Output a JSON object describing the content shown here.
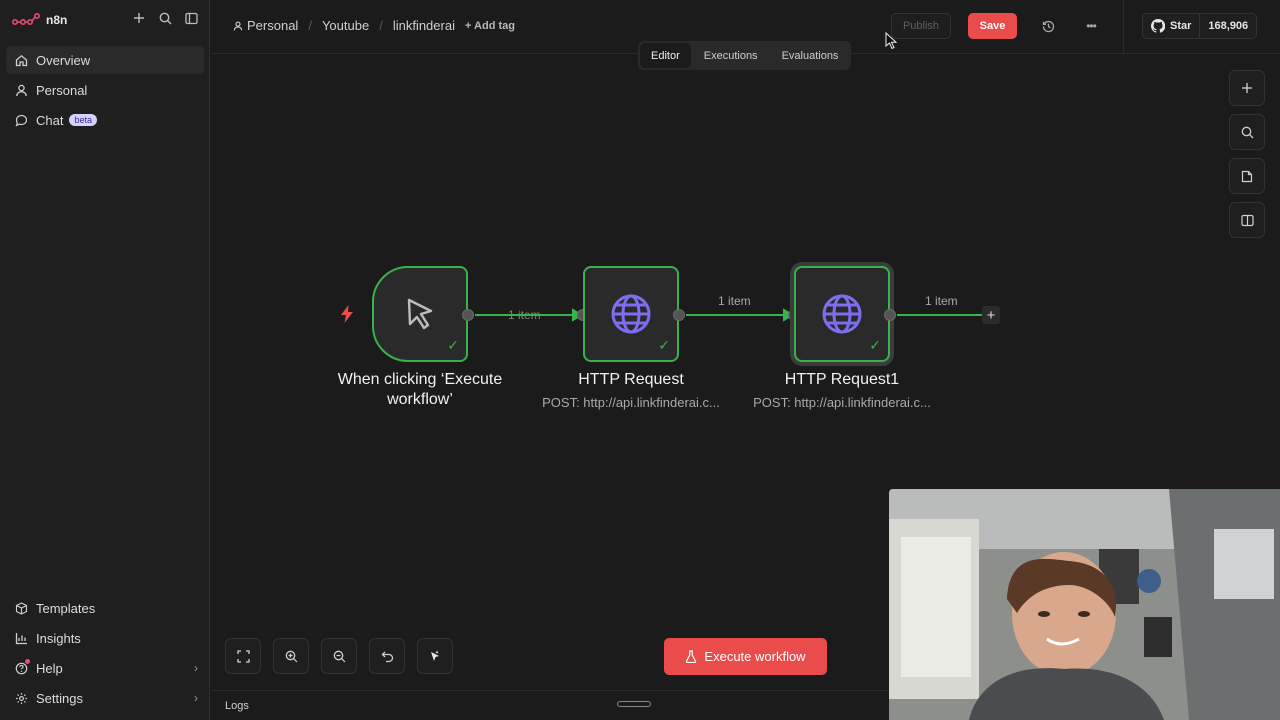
{
  "brand": {
    "name": "n8n"
  },
  "sidebar": {
    "items": [
      {
        "label": "Overview",
        "icon": "home-icon",
        "active": true
      },
      {
        "label": "Personal",
        "icon": "user-icon"
      },
      {
        "label": "Chat",
        "icon": "chat-icon",
        "badge": "beta"
      }
    ],
    "bottom": [
      {
        "label": "Templates",
        "icon": "box-icon"
      },
      {
        "label": "Insights",
        "icon": "chart-icon"
      },
      {
        "label": "Help",
        "icon": "help-icon"
      },
      {
        "label": "Settings",
        "icon": "gear-icon"
      }
    ]
  },
  "breadcrumb": {
    "owner": "Personal",
    "folder": "Youtube",
    "workflow": "linkfinderai",
    "add_tag": "+ Add tag"
  },
  "header": {
    "publish_label": "Publish",
    "save_label": "Save",
    "star_label": "Star",
    "star_count": "168,906"
  },
  "tabs": [
    {
      "label": "Editor",
      "active": true
    },
    {
      "label": "Executions"
    },
    {
      "label": "Evaluations"
    }
  ],
  "nodes": [
    {
      "title": "When clicking ‘Execute workflow’",
      "subtitle": ""
    },
    {
      "title": "HTTP Request",
      "subtitle": "POST: http://api.linkfinderai.c..."
    },
    {
      "title": "HTTP Request1",
      "subtitle": "POST: http://api.linkfinderai.c..."
    }
  ],
  "edges": [
    {
      "label": "1 item"
    },
    {
      "label": "1 item"
    },
    {
      "label": "1 item"
    }
  ],
  "actions": {
    "execute_label": "Execute workflow"
  },
  "logs": {
    "label": "Logs"
  },
  "colors": {
    "accent": "#ea4b4b",
    "success": "#37b34a",
    "node_icon": "#7b6ff0",
    "brand": "#ea4b71"
  }
}
